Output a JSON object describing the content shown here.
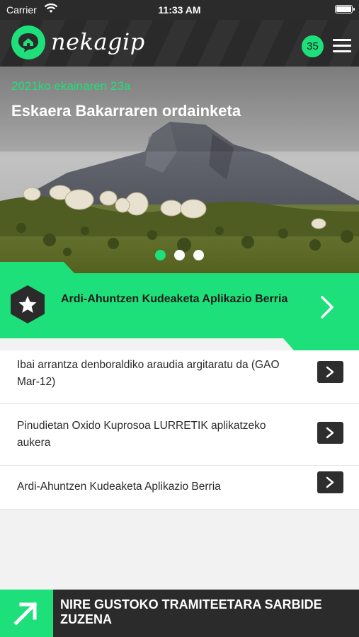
{
  "status_bar": {
    "carrier": "Carrier",
    "time": "11:33 AM"
  },
  "header": {
    "app_name": "nekagip",
    "notification_count": "35"
  },
  "hero": {
    "date": "2021ko ekainaren 23a",
    "title": "Eskaera Bakarraren ordainketa",
    "slides_total": 3,
    "active_slide": 1
  },
  "featured": {
    "title": "Ardi-Ahuntzen Kudeaketa Aplikazio Berria"
  },
  "news": [
    {
      "text": "Ibai arrantza denboraldiko araudia argitaratu da (GAO Mar-12)"
    },
    {
      "text": "Pinudietan Oxido Kuprosoa LURRETIK aplikatzeko aukera"
    },
    {
      "text": "Ardi-Ahuntzen Kudeaketa Aplikazio Berria"
    }
  ],
  "footer": {
    "label": "NIRE GUSTOKO TRAMITEETARA SARBIDE ZUZENA"
  },
  "colors": {
    "accent": "#1ee07a",
    "dark": "#2b2b2b"
  },
  "icons": [
    "wifi-icon",
    "battery-icon",
    "home-chat-icon",
    "menu-icon",
    "star-icon",
    "chevron-right-icon",
    "arrow-up-right-icon"
  ]
}
